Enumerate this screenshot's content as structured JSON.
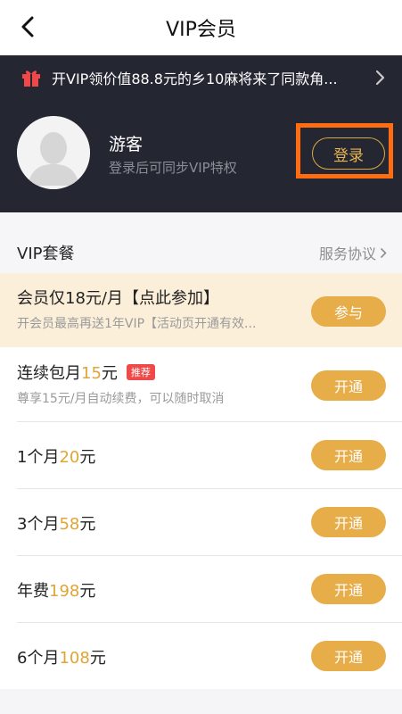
{
  "header": {
    "title": "VIP会员",
    "back_icon": "chevron-left-icon"
  },
  "promo": {
    "icon": "gift-icon",
    "text": "开VIP领价值88.8元的乡10麻将来了同款角...",
    "arrow_icon": "chevron-right-icon"
  },
  "user": {
    "name": "游客",
    "subtitle": "登录后可同步VIP特权",
    "login_label": "登录",
    "avatar_icon": "default-avatar-icon"
  },
  "plans": {
    "title": "VIP套餐",
    "agreement_label": "服务协议",
    "items": [
      {
        "title": "会员仅18元/月【点此参加】",
        "subtitle": "开会员最高再送1年VIP【活动页开通有效...",
        "button": "参与"
      },
      {
        "title_prefix": "连续包月",
        "price": "15",
        "unit": "元",
        "badge": "推荐",
        "subtitle": "尊享15元/月自动续费，可以随时取消",
        "button": "开通"
      },
      {
        "title_prefix": "1个月",
        "price": "20",
        "unit": "元",
        "button": "开通"
      },
      {
        "title_prefix": "3个月",
        "price": "58",
        "unit": "元",
        "button": "开通"
      },
      {
        "title_prefix": "年费",
        "price": "198",
        "unit": "元",
        "button": "开通"
      },
      {
        "title_prefix": "6个月",
        "price": "108",
        "unit": "元",
        "button": "开通"
      }
    ]
  },
  "colors": {
    "accent": "#e7ad49",
    "dark_bg": "#242631",
    "highlight_bg": "#fcefd9",
    "login_frame": "#ff6d13"
  }
}
